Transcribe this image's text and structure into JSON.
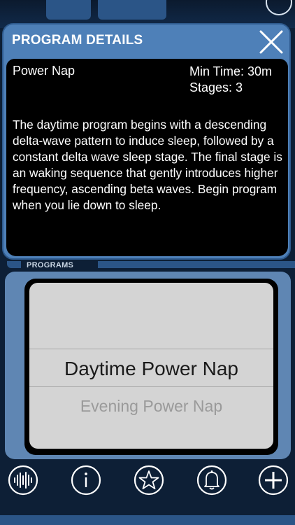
{
  "details": {
    "header": "PROGRAM DETAILS",
    "program_name": "Power Nap",
    "min_time": "Min Time: 30m",
    "stages": "Stages: 3",
    "description": "The daytime program begins with a descending delta-wave pattern to induce sleep, followed by a constant delta wave sleep stage.  The final stage is an waking sequence that gently introduces higher frequency, ascending beta waves.  Begin program when you lie down to sleep."
  },
  "programs": {
    "label": "PROGRAMS",
    "selected": "Daytime Power Nap",
    "next": "Evening Power Nap"
  },
  "toolbar": {
    "icons": [
      "waveform-icon",
      "info-icon",
      "star-icon",
      "bell-icon",
      "plus-icon"
    ]
  },
  "colors": {
    "panel": "#4e80b8",
    "accent_dark": "#2b5587",
    "picker_bg": "#d4d4d4"
  }
}
